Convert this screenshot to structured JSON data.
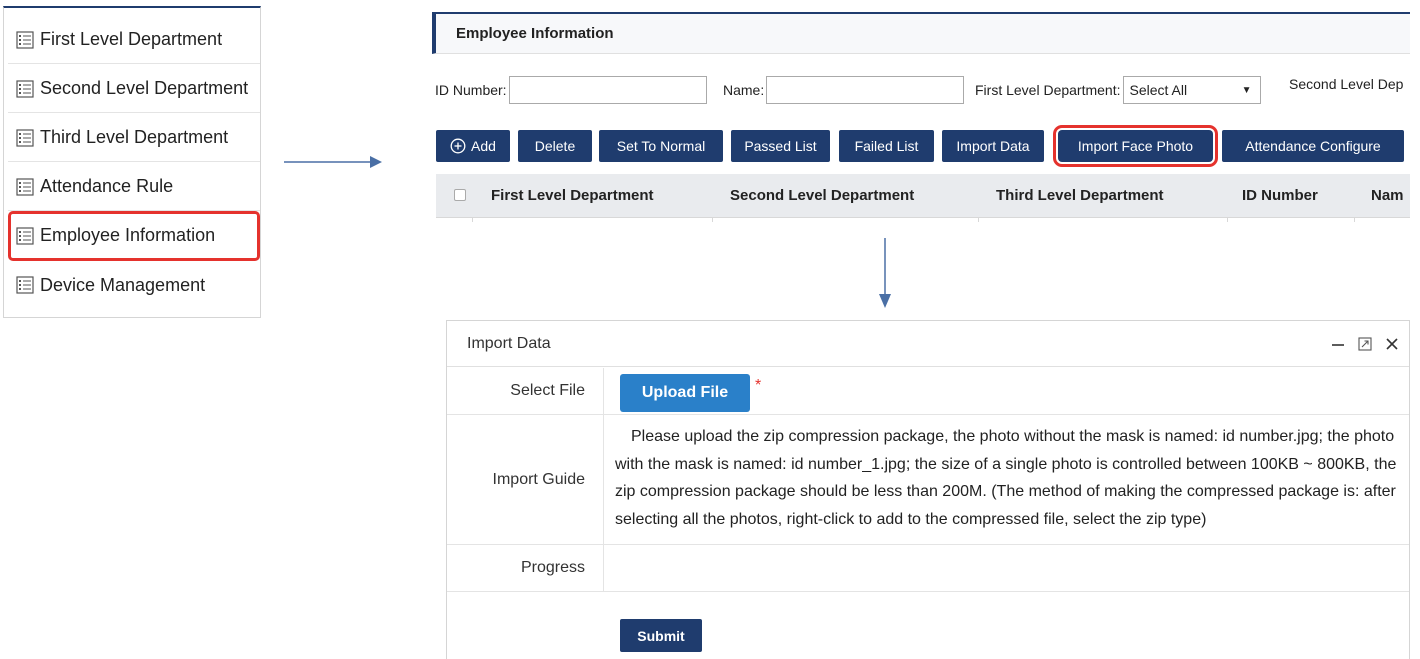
{
  "menu": {
    "items": [
      {
        "label": "First Level Department",
        "icon": "list-icon"
      },
      {
        "label": "Second Level Department",
        "icon": "list-icon"
      },
      {
        "label": "Third Level Department",
        "icon": "list-icon"
      },
      {
        "label": "Attendance Rule",
        "icon": "list-icon"
      },
      {
        "label": "Employee Information",
        "icon": "list-icon",
        "highlighted": true
      },
      {
        "label": "Device Management",
        "icon": "list-icon"
      }
    ]
  },
  "employee_panel": {
    "title": "Employee Information",
    "filters": {
      "id_number_label": "ID Number:",
      "id_number_value": "",
      "name_label": "Name:",
      "name_value": "",
      "first_dept_label": "First Level Department:",
      "first_dept_value": "Select All",
      "second_dept_label": "Second Level Dep"
    },
    "toolbar": {
      "add": "Add",
      "add_icon": "plus-circle-icon",
      "delete": "Delete",
      "set_to_normal": "Set To Normal",
      "passed_list": "Passed List",
      "failed_list": "Failed List",
      "import_data": "Import Data",
      "import_face_photo": "Import Face Photo",
      "attendance_configure": "Attendance Configure"
    },
    "table_headers": [
      "First Level Department",
      "Second Level Department",
      "Third Level Department",
      "ID Number",
      "Nam"
    ]
  },
  "dialog": {
    "title": "Import Data",
    "minimize_icon": "minimize-icon",
    "maximize_icon": "maximize-icon",
    "close_icon": "close-icon",
    "select_file_label": "Select File",
    "upload_button": "Upload File",
    "required_mark": "*",
    "import_guide_label": "Import Guide",
    "import_guide_text": "Please upload the zip compression package, the photo without the mask is named: id number.jpg; the photo with the mask is named: id number_1.jpg; the size of a single photo is controlled between 100KB ~ 800KB, the zip compression package should be less than 200M. (The method of making the compressed package is: after selecting all the photos, right-click to add to the compressed file, select the zip type)",
    "progress_label": "Progress",
    "submit_button": "Submit"
  },
  "colors": {
    "navy": "#1f3c6e",
    "highlight_red": "#e5322d",
    "upload_blue": "#2a80c9",
    "arrow_blue": "#4a6fa5"
  }
}
